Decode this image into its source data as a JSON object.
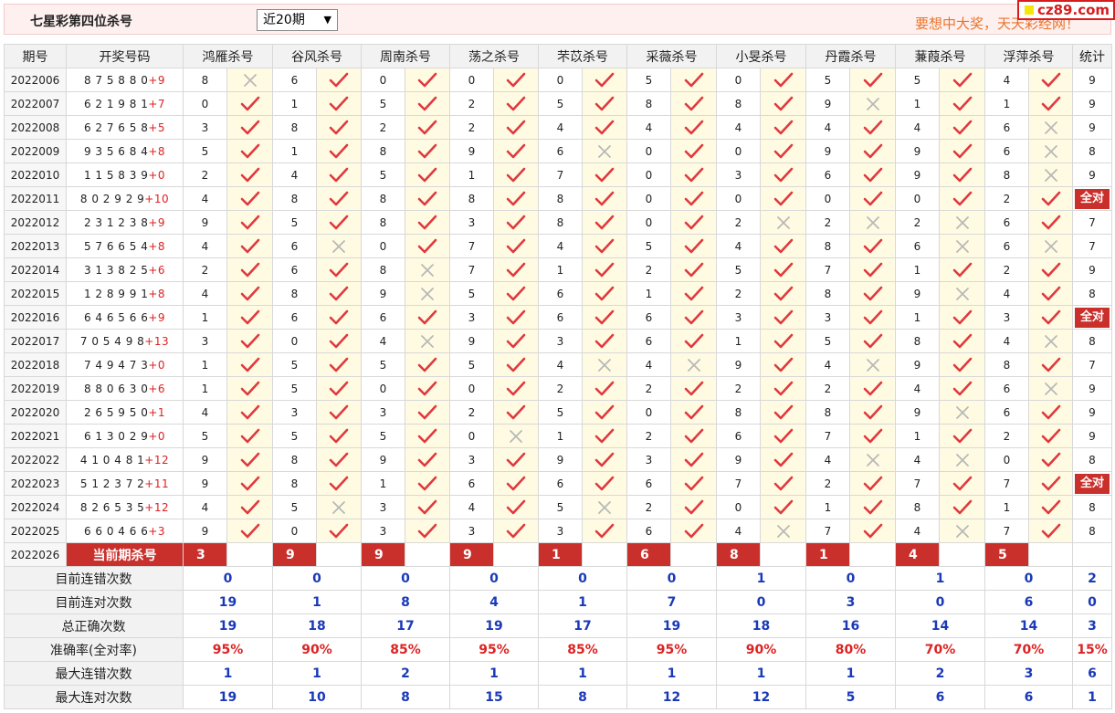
{
  "header": {
    "title": "七星彩第四位杀号",
    "period_select": "近20期",
    "slogan": "要想中大奖，天天彩经网！",
    "site": "cz89.com"
  },
  "columns": {
    "issue": "期号",
    "draw": "开奖号码",
    "experts": [
      "鸿雁杀号",
      "谷风杀号",
      "周南杀号",
      "荡之杀号",
      "芣苡杀号",
      "采薇杀号",
      "小旻杀号",
      "丹霞杀号",
      "蒹葭杀号",
      "浮萍杀号"
    ],
    "stat": "统计"
  },
  "rows": [
    {
      "issue": "2022006",
      "draw": "8 7 5 8 8 0",
      "sum": "+9",
      "picks": [
        "8",
        "6",
        "0",
        "0",
        "0",
        "5",
        "0",
        "5",
        "5",
        "4"
      ],
      "marks": [
        0,
        1,
        1,
        1,
        1,
        1,
        1,
        1,
        1,
        1
      ],
      "stat": "9"
    },
    {
      "issue": "2022007",
      "draw": "6 2 1 9 8 1",
      "sum": "+7",
      "picks": [
        "0",
        "1",
        "5",
        "2",
        "5",
        "8",
        "8",
        "9",
        "1",
        "1"
      ],
      "marks": [
        1,
        1,
        1,
        1,
        1,
        1,
        1,
        0,
        1,
        1
      ],
      "stat": "9"
    },
    {
      "issue": "2022008",
      "draw": "6 2 7 6 5 8",
      "sum": "+5",
      "picks": [
        "3",
        "8",
        "2",
        "2",
        "4",
        "4",
        "4",
        "4",
        "4",
        "6"
      ],
      "marks": [
        1,
        1,
        1,
        1,
        1,
        1,
        1,
        1,
        1,
        0
      ],
      "stat": "9"
    },
    {
      "issue": "2022009",
      "draw": "9 3 5 6 8 4",
      "sum": "+8",
      "picks": [
        "5",
        "1",
        "8",
        "9",
        "6",
        "0",
        "0",
        "9",
        "9",
        "6"
      ],
      "marks": [
        1,
        1,
        1,
        1,
        0,
        1,
        1,
        1,
        1,
        0
      ],
      "stat": "8"
    },
    {
      "issue": "2022010",
      "draw": "1 1 5 8 3 9",
      "sum": "+0",
      "picks": [
        "2",
        "4",
        "5",
        "1",
        "7",
        "0",
        "3",
        "6",
        "9",
        "8"
      ],
      "marks": [
        1,
        1,
        1,
        1,
        1,
        1,
        1,
        1,
        1,
        0
      ],
      "stat": "9"
    },
    {
      "issue": "2022011",
      "draw": "8 0 2 9 2 9",
      "sum": "+10",
      "picks": [
        "4",
        "8",
        "8",
        "8",
        "8",
        "0",
        "0",
        "0",
        "0",
        "2"
      ],
      "marks": [
        1,
        1,
        1,
        1,
        1,
        1,
        1,
        1,
        1,
        1
      ],
      "stat": "全对"
    },
    {
      "issue": "2022012",
      "draw": "2 3 1 2 3 8",
      "sum": "+9",
      "picks": [
        "9",
        "5",
        "8",
        "3",
        "8",
        "0",
        "2",
        "2",
        "2",
        "6"
      ],
      "marks": [
        1,
        1,
        1,
        1,
        1,
        1,
        0,
        0,
        0,
        1
      ],
      "stat": "7"
    },
    {
      "issue": "2022013",
      "draw": "5 7 6 6 5 4",
      "sum": "+8",
      "picks": [
        "4",
        "6",
        "0",
        "7",
        "4",
        "5",
        "4",
        "8",
        "6",
        "6"
      ],
      "marks": [
        1,
        0,
        1,
        1,
        1,
        1,
        1,
        1,
        0,
        0
      ],
      "stat": "7"
    },
    {
      "issue": "2022014",
      "draw": "3 1 3 8 2 5",
      "sum": "+6",
      "picks": [
        "2",
        "6",
        "8",
        "7",
        "1",
        "2",
        "5",
        "7",
        "1",
        "2"
      ],
      "marks": [
        1,
        1,
        0,
        1,
        1,
        1,
        1,
        1,
        1,
        1
      ],
      "stat": "9"
    },
    {
      "issue": "2022015",
      "draw": "1 2 8 9 9 1",
      "sum": "+8",
      "picks": [
        "4",
        "8",
        "9",
        "5",
        "6",
        "1",
        "2",
        "8",
        "9",
        "4"
      ],
      "marks": [
        1,
        1,
        0,
        1,
        1,
        1,
        1,
        1,
        0,
        1
      ],
      "stat": "8"
    },
    {
      "issue": "2022016",
      "draw": "6 4 6 5 6 6",
      "sum": "+9",
      "picks": [
        "1",
        "6",
        "6",
        "3",
        "6",
        "6",
        "3",
        "3",
        "1",
        "3"
      ],
      "marks": [
        1,
        1,
        1,
        1,
        1,
        1,
        1,
        1,
        1,
        1
      ],
      "stat": "全对"
    },
    {
      "issue": "2022017",
      "draw": "7 0 5 4 9 8",
      "sum": "+13",
      "picks": [
        "3",
        "0",
        "4",
        "9",
        "3",
        "6",
        "1",
        "5",
        "8",
        "4"
      ],
      "marks": [
        1,
        1,
        0,
        1,
        1,
        1,
        1,
        1,
        1,
        0
      ],
      "stat": "8"
    },
    {
      "issue": "2022018",
      "draw": "7 4 9 4 7 3",
      "sum": "+0",
      "picks": [
        "1",
        "5",
        "5",
        "5",
        "4",
        "4",
        "9",
        "4",
        "9",
        "8"
      ],
      "marks": [
        1,
        1,
        1,
        1,
        0,
        0,
        1,
        0,
        1,
        1
      ],
      "stat": "7"
    },
    {
      "issue": "2022019",
      "draw": "8 8 0 6 3 0",
      "sum": "+6",
      "picks": [
        "1",
        "5",
        "0",
        "0",
        "2",
        "2",
        "2",
        "2",
        "4",
        "6"
      ],
      "marks": [
        1,
        1,
        1,
        1,
        1,
        1,
        1,
        1,
        1,
        0
      ],
      "stat": "9"
    },
    {
      "issue": "2022020",
      "draw": "2 6 5 9 5 0",
      "sum": "+1",
      "picks": [
        "4",
        "3",
        "3",
        "2",
        "5",
        "0",
        "8",
        "8",
        "9",
        "6"
      ],
      "marks": [
        1,
        1,
        1,
        1,
        1,
        1,
        1,
        1,
        0,
        1
      ],
      "stat": "9"
    },
    {
      "issue": "2022021",
      "draw": "6 1 3 0 2 9",
      "sum": "+0",
      "picks": [
        "5",
        "5",
        "5",
        "0",
        "1",
        "2",
        "6",
        "7",
        "1",
        "2"
      ],
      "marks": [
        1,
        1,
        1,
        0,
        1,
        1,
        1,
        1,
        1,
        1
      ],
      "stat": "9"
    },
    {
      "issue": "2022022",
      "draw": "4 1 0 4 8 1",
      "sum": "+12",
      "picks": [
        "9",
        "8",
        "9",
        "3",
        "9",
        "3",
        "9",
        "4",
        "4",
        "0"
      ],
      "marks": [
        1,
        1,
        1,
        1,
        1,
        1,
        1,
        0,
        0,
        1
      ],
      "stat": "8"
    },
    {
      "issue": "2022023",
      "draw": "5 1 2 3 7 2",
      "sum": "+11",
      "picks": [
        "9",
        "8",
        "1",
        "6",
        "6",
        "6",
        "7",
        "2",
        "7",
        "7"
      ],
      "marks": [
        1,
        1,
        1,
        1,
        1,
        1,
        1,
        1,
        1,
        1
      ],
      "stat": "全对"
    },
    {
      "issue": "2022024",
      "draw": "8 2 6 5 3 5",
      "sum": "+12",
      "picks": [
        "4",
        "5",
        "3",
        "4",
        "5",
        "2",
        "0",
        "1",
        "8",
        "1"
      ],
      "marks": [
        1,
        0,
        1,
        1,
        0,
        1,
        1,
        1,
        1,
        1
      ],
      "stat": "8"
    },
    {
      "issue": "2022025",
      "draw": "6 6 0 4 6 6",
      "sum": "+3",
      "picks": [
        "9",
        "0",
        "3",
        "3",
        "3",
        "6",
        "4",
        "7",
        "4",
        "7"
      ],
      "marks": [
        1,
        1,
        1,
        1,
        1,
        1,
        0,
        1,
        0,
        1
      ],
      "stat": "8"
    }
  ],
  "current": {
    "issue": "2022026",
    "label": "当前期杀号",
    "picks": [
      "3",
      "9",
      "9",
      "9",
      "1",
      "6",
      "8",
      "1",
      "4",
      "5"
    ]
  },
  "summary": [
    {
      "label": "目前连错次数",
      "values": [
        "0",
        "0",
        "0",
        "0",
        "0",
        "0",
        "1",
        "0",
        "1",
        "0"
      ],
      "stat": "2"
    },
    {
      "label": "目前连对次数",
      "values": [
        "19",
        "1",
        "8",
        "4",
        "1",
        "7",
        "0",
        "3",
        "0",
        "6"
      ],
      "stat": "0"
    },
    {
      "label": "总正确次数",
      "values": [
        "19",
        "18",
        "17",
        "19",
        "17",
        "19",
        "18",
        "16",
        "14",
        "14"
      ],
      "stat": "3"
    },
    {
      "label": "准确率(全对率)",
      "values": [
        "95%",
        "90%",
        "85%",
        "95%",
        "85%",
        "95%",
        "90%",
        "80%",
        "70%",
        "70%"
      ],
      "stat": "15%",
      "pct": true
    },
    {
      "label": "最大连错次数",
      "values": [
        "1",
        "1",
        "2",
        "1",
        "1",
        "1",
        "1",
        "1",
        "2",
        "3"
      ],
      "stat": "6"
    },
    {
      "label": "最大连对次数",
      "values": [
        "19",
        "10",
        "8",
        "15",
        "8",
        "12",
        "12",
        "5",
        "6",
        "6"
      ],
      "stat": "1"
    }
  ],
  "colors": {
    "check": "#e0393e",
    "cross": "#b8b8b8",
    "accent": "#c9302c",
    "value_blue": "#1a39b8"
  },
  "icons": {
    "correct": "check-icon",
    "wrong": "cross-icon"
  }
}
